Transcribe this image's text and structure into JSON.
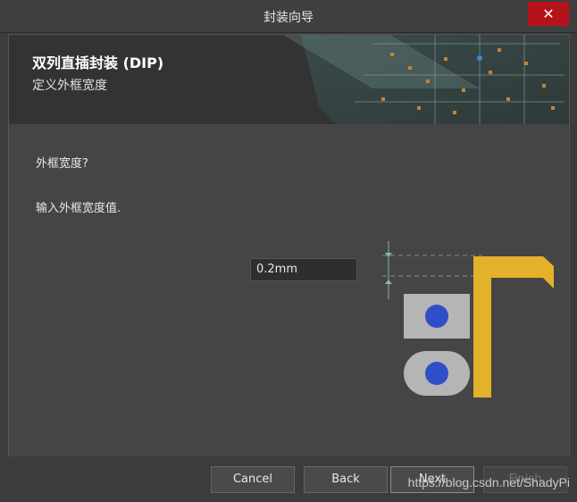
{
  "window": {
    "title": "封装向导",
    "close_label": "✕"
  },
  "header": {
    "title": "双列直插封装 (DIP)",
    "subtitle": "定义外框宽度"
  },
  "content": {
    "question": "外框宽度?",
    "instruction": "输入外框宽度值.",
    "outline_width_value": "0.2mm"
  },
  "buttons": {
    "cancel": "Cancel",
    "back": "Back",
    "next": "Next",
    "finish": "Finish"
  },
  "watermark": "https://blog.csdn.net/ShadyPi",
  "colors": {
    "pad": "#2f4fc9",
    "pad_ring": "#b5b5b5",
    "outline": "#e4b12a",
    "close": "#b5131b"
  }
}
